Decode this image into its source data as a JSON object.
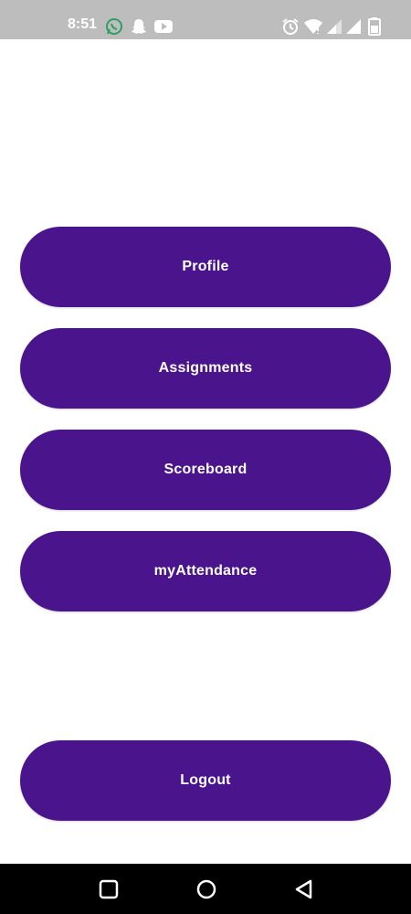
{
  "status_bar": {
    "time": "8:51",
    "left_icons": [
      "whatsapp-icon",
      "snapchat-icon",
      "youtube-icon"
    ],
    "right_icons": [
      "alarm-icon",
      "wifi-icon",
      "signal-icon",
      "signal-icon",
      "battery-icon"
    ]
  },
  "menu": {
    "profile_label": "Profile",
    "assignments_label": "Assignments",
    "scoreboard_label": "Scoreboard",
    "attendance_label": "myAttendance",
    "logout_label": "Logout"
  },
  "colors": {
    "button": "#4a148c",
    "button_text": "#ffffff",
    "status_bar": "#bdbdbd",
    "nav_bar": "#000000"
  },
  "nav_bar": {
    "icons": [
      "recent-apps-icon",
      "home-icon",
      "back-icon"
    ]
  }
}
